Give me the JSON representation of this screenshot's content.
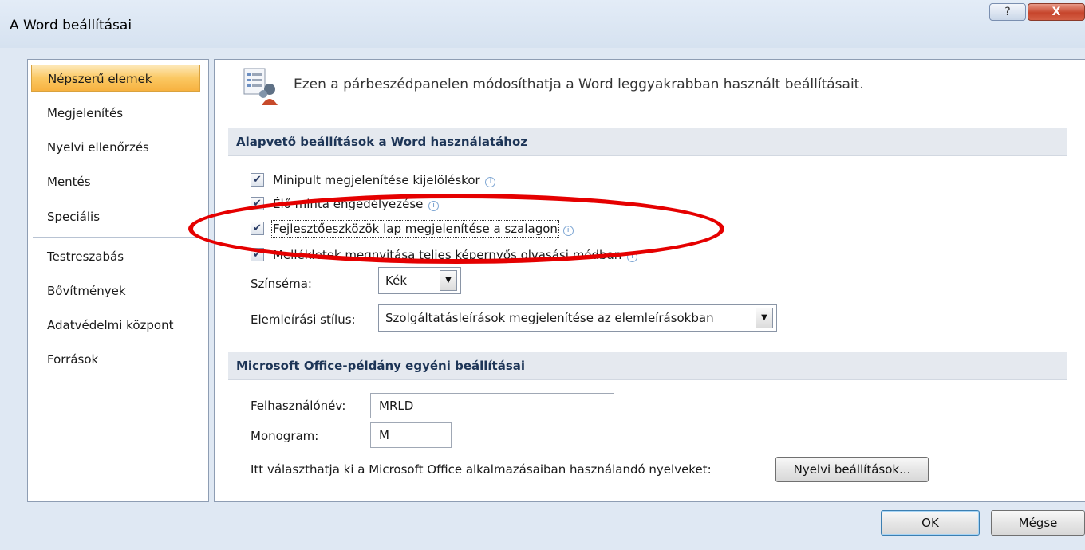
{
  "window": {
    "title": "A Word beállításai",
    "help_label": "?",
    "close_label": "X"
  },
  "sidebar": {
    "items": [
      {
        "label": "Népszerű elemek",
        "active": true
      },
      {
        "label": "Megjelenítés"
      },
      {
        "label": "Nyelvi ellenőrzés"
      },
      {
        "label": "Mentés"
      },
      {
        "label": "Speciális"
      },
      {
        "label": "Testreszabás"
      },
      {
        "label": "Bővítmények"
      },
      {
        "label": "Adatvédelmi központ"
      },
      {
        "label": "Források"
      }
    ]
  },
  "main": {
    "header_text": "Ezen a párbeszédpanelen módosíthatja a Word leggyakrabban használt beállításait.",
    "section1_title": "Alapvető beállítások a Word használatához",
    "checkboxes": [
      {
        "label": "Minipult megjelenítése kijelöléskor",
        "checked": true
      },
      {
        "label": "Élő minta engedélyezése",
        "checked": true
      },
      {
        "label": "Fejlesztőeszközök lap megjelenítése a szalagon",
        "checked": true
      },
      {
        "label": "Mellékletek megnyitása teljes képernyős olvasási módban",
        "checked": true
      }
    ],
    "check_glyph": "✔",
    "info_glyph": "i",
    "color_scheme_label": "Színséma:",
    "color_scheme_value": "Kék",
    "tooltip_style_label": "Elemleírási stílus:",
    "tooltip_style_value": "Szolgáltatásleírások megjelenítése az elemleírásokban",
    "dropdown_glyph": "▼",
    "section2_title": "Microsoft Office-példány egyéni beállításai",
    "username_label": "Felhasználónév:",
    "username_value": "MRLD",
    "initials_label": "Monogram:",
    "initials_value": "M",
    "language_text": "Itt választhatja ki a Microsoft Office alkalmazásaiban használandó nyelveket:",
    "language_button": "Nyelvi beállítások..."
  },
  "footer": {
    "ok_label": "OK",
    "cancel_label": "Mégse"
  },
  "colors": {
    "annotation_red": "#e50000",
    "active_nav": "#fbc862",
    "section_title": "#1d3557"
  }
}
